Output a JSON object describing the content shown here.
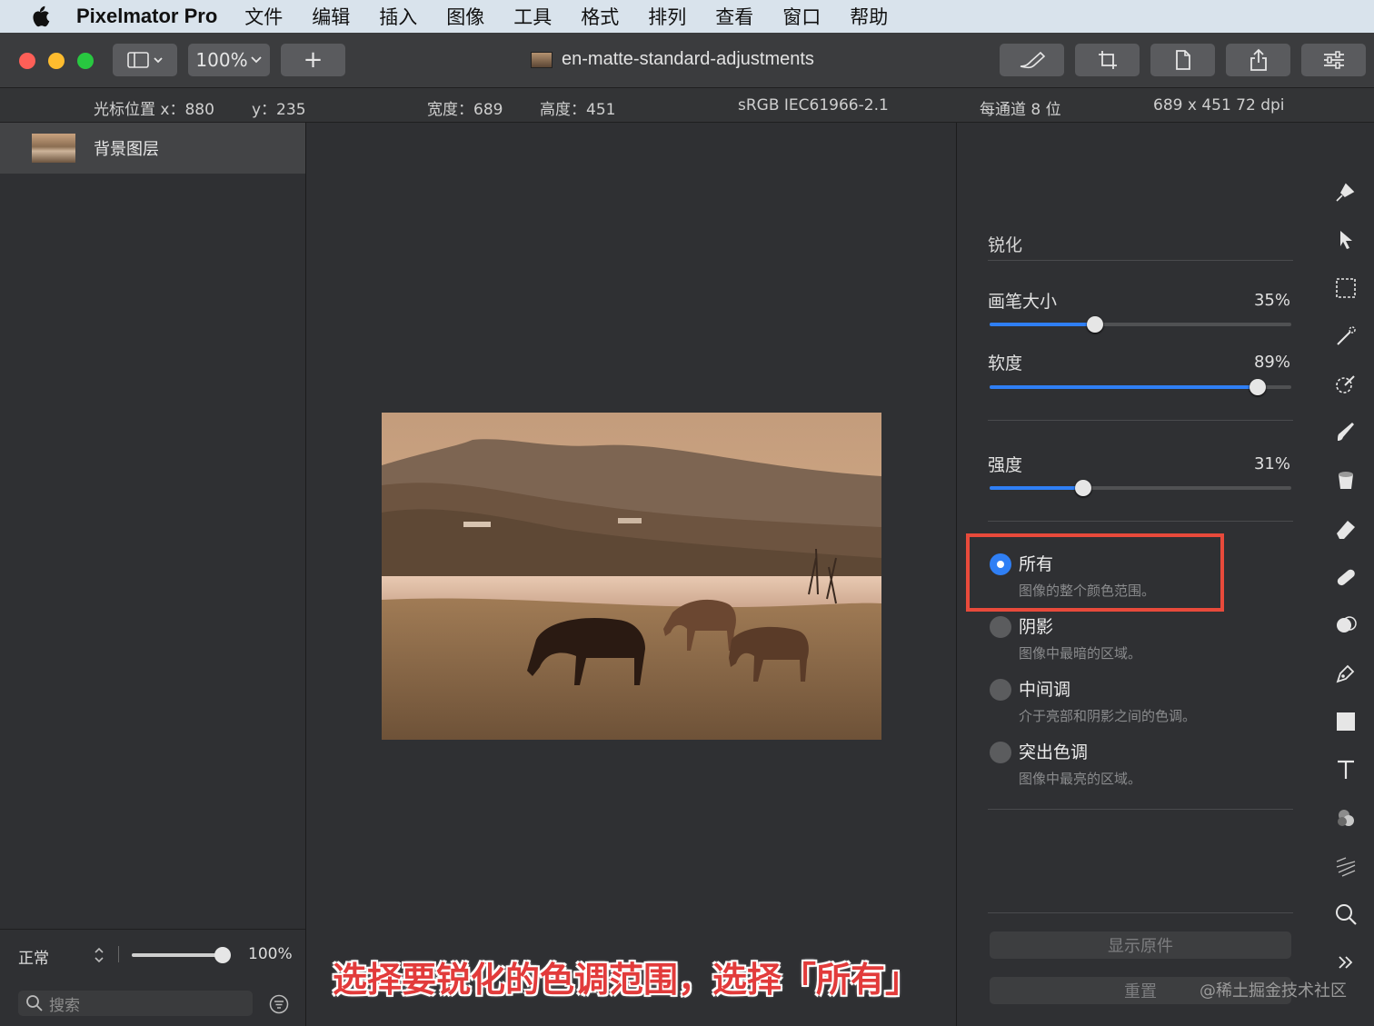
{
  "menubar": {
    "app_name": "Pixelmator Pro",
    "menus": [
      "文件",
      "编辑",
      "插入",
      "图像",
      "工具",
      "格式",
      "排列",
      "查看",
      "窗口",
      "帮助"
    ]
  },
  "toolbar": {
    "zoom": "100%",
    "add_label": "+",
    "document_title": "en-matte-standard-adjustments"
  },
  "infobar": {
    "cursor_x": "光标位置 x：880",
    "cursor_y": "y：235",
    "width": "宽度：689",
    "height": "高度：451",
    "color_profile": "sRGB IEC61966-2.1",
    "bit_depth": "每通道 8 位",
    "resolution": "689 x 451 72 dpi"
  },
  "layers": {
    "items": [
      {
        "name": "背景图层"
      }
    ],
    "blend_mode": "正常",
    "opacity": "100%",
    "opacity_value": 1.0,
    "search_placeholder": "搜索"
  },
  "sharpen": {
    "section_title": "锐化",
    "sliders": [
      {
        "label": "画笔大小",
        "value": "35%",
        "fraction": 0.35
      },
      {
        "label": "软度",
        "value": "89%",
        "fraction": 0.89
      },
      {
        "label": "强度",
        "value": "31%",
        "fraction": 0.31
      }
    ],
    "tone_options": [
      {
        "title": "所有",
        "desc": "图像的整个颜色范围。",
        "selected": true
      },
      {
        "title": "阴影",
        "desc": "图像中最暗的区域。",
        "selected": false
      },
      {
        "title": "中间调",
        "desc": "介于亮部和阴影之间的色调。",
        "selected": false
      },
      {
        "title": "突出色调",
        "desc": "图像中最亮的区域。",
        "selected": false
      }
    ],
    "show_original": "显示原件",
    "reset": "重置"
  },
  "caption": "选择要锐化的色调范围，选择「所有」",
  "watermark": "@稀土掘金技术社区",
  "colors": {
    "accent": "#2f7ff5",
    "highlight_box": "#e84a3b",
    "caption": "#e23b3b"
  },
  "tools": [
    "paint-icon",
    "arrange-icon",
    "rect-select-icon",
    "magic-wand-icon",
    "quick-select-icon",
    "brush-icon",
    "fill-icon",
    "eraser-icon",
    "repair-icon",
    "clone-icon",
    "pen-icon",
    "shape-icon",
    "type-icon",
    "color-adjust-icon",
    "effects-icon",
    "zoom-icon",
    "more-tools-icon"
  ]
}
